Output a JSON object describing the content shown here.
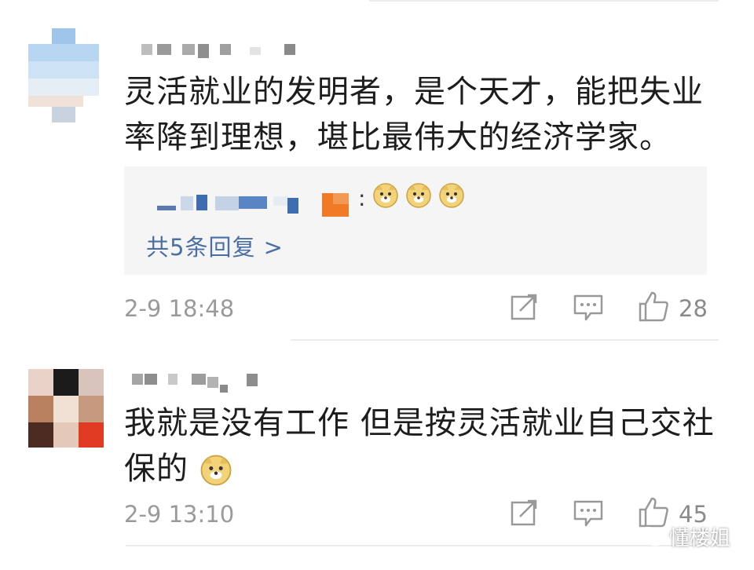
{
  "comments": [
    {
      "text_line1": "灵活就业的发明者，是个天才，能把失业",
      "text_line2": "率降到理想，堪比最伟大的经济学家。",
      "reply_more": "共5条回复 >",
      "time": "2-9 18:48",
      "likes": "28",
      "actions": [
        "share-icon",
        "comment-icon",
        "thumbs-up-icon"
      ]
    },
    {
      "text_line1": "我就是没有工作 但是按灵活就业自己交社",
      "text_line2": "保的",
      "time": "2-9 13:10",
      "likes": "45",
      "actions": [
        "share-icon",
        "comment-icon",
        "thumbs-up-icon"
      ]
    }
  ],
  "watermark": {
    "text": "懂楼姐",
    "icon": "wechat-icon"
  },
  "colors": {
    "link": "#4a6fa3",
    "muted": "#9a9a9a",
    "reply_bg": "#f5f5f6"
  }
}
